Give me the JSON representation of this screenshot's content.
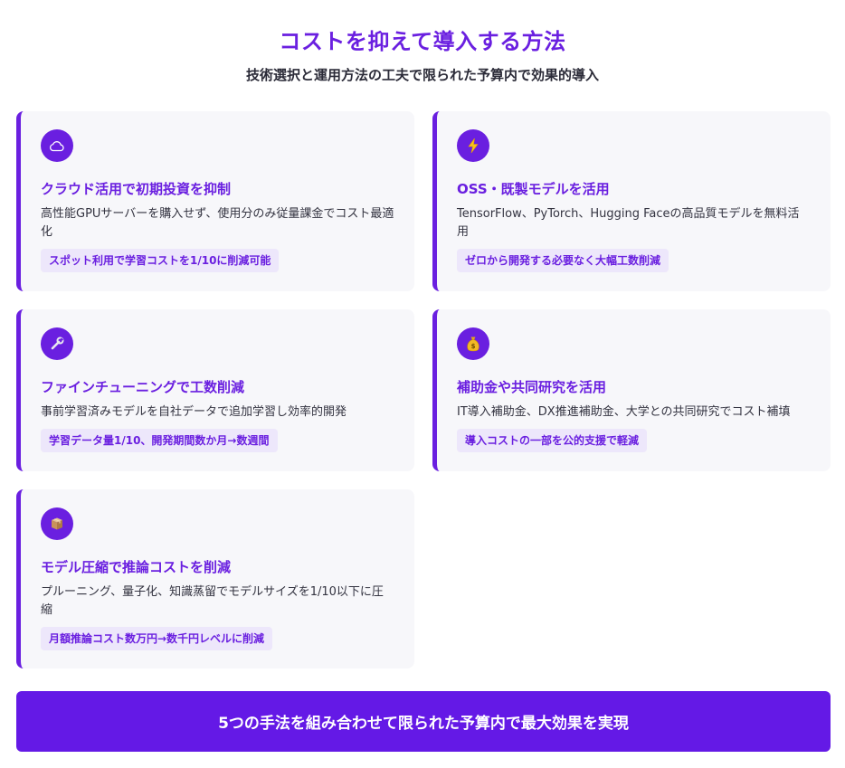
{
  "header": {
    "title": "コストを抑えて導入する方法",
    "subtitle": "技術選択と運用方法の工夫で限られた予算内で効果的導入"
  },
  "colors": {
    "accent": "#6a1fe0",
    "card_bg": "#f7f7fa",
    "tag_bg": "#ede7fb",
    "banner_bg": "#6419e6"
  },
  "cards": [
    {
      "icon": "cloud-icon",
      "title": "クラウド活用で初期投資を抑制",
      "description": "高性能GPUサーバーを購入せず、使用分のみ従量課金でコスト最適化",
      "tag": "スポット利用で学習コストを1/10に削減可能"
    },
    {
      "icon": "lightning-icon",
      "title": "OSS・既製モデルを活用",
      "description": "TensorFlow、PyTorch、Hugging Faceの高品質モデルを無料活用",
      "tag": "ゼロから開発する必要なく大幅工数削減"
    },
    {
      "icon": "wrench-icon",
      "title": "ファインチューニングで工数削減",
      "description": "事前学習済みモデルを自社データで追加学習し効率的開発",
      "tag": "学習データ量1/10、開発期間数か月→数週間"
    },
    {
      "icon": "money-bag-icon",
      "title": "補助金や共同研究を活用",
      "description": "IT導入補助金、DX推進補助金、大学との共同研究でコスト補填",
      "tag": "導入コストの一部を公的支援で軽減"
    },
    {
      "icon": "package-icon",
      "title": "モデル圧縮で推論コストを削減",
      "description": "プルーニング、量子化、知識蒸留でモデルサイズを1/10以下に圧縮",
      "tag": "月額推論コスト数万円→数千円レベルに削減"
    }
  ],
  "banner": {
    "text": "5つの手法を組み合わせて限られた予算内で最大効果を実現"
  }
}
